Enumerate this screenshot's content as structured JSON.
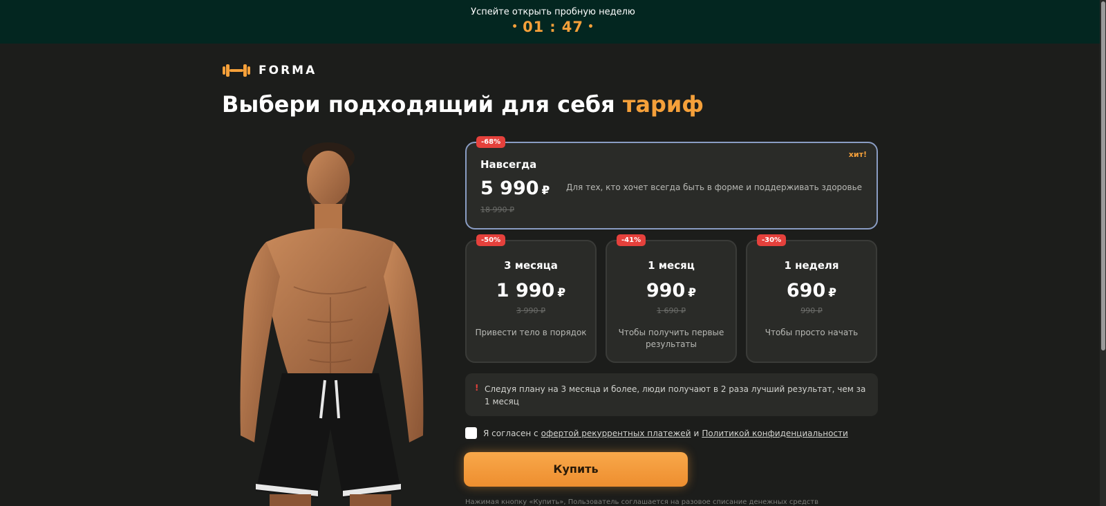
{
  "banner": {
    "text": "Успейте открыть пробную неделю",
    "timer_minutes": "01",
    "timer_seconds": "47",
    "dot": "•",
    "colon": ":"
  },
  "logo": {
    "text": "FORMA"
  },
  "heading": {
    "main": "Выбери подходящий для себя ",
    "accent": "тариф"
  },
  "plans": {
    "forever": {
      "badge": "-68%",
      "hit": "хит!",
      "title": "Навсегда",
      "price": "5 990",
      "currency": "₽",
      "old_price": "18 990 ₽",
      "description": "Для тех, кто хочет всегда быть в форме и поддерживать здоровье"
    },
    "items": [
      {
        "badge": "-50%",
        "title": "3 месяца",
        "price": "1 990",
        "currency": "₽",
        "old_price": "3 990 ₽",
        "description": "Привести тело в порядок"
      },
      {
        "badge": "-41%",
        "title": "1 месяц",
        "price": "990",
        "currency": "₽",
        "old_price": "1 690 ₽",
        "description": "Чтобы получить первые результаты"
      },
      {
        "badge": "-30%",
        "title": "1 неделя",
        "price": "690",
        "currency": "₽",
        "old_price": "990 ₽",
        "description": "Чтобы просто начать"
      }
    ]
  },
  "info": {
    "mark": "!",
    "text": "Следуя плану на 3 месяца и более, люди получают в 2 раза лучший результат, чем за 1 месяц"
  },
  "agreement": {
    "prefix": "Я согласен с",
    "offer_link": "офертой рекуррентных платежей",
    "and": "и",
    "policy_link": "Политикой конфиденциальности"
  },
  "buy_button": "Купить",
  "footnote": "Нажимая кнопку «Купить», Пользователь соглашается на разовое списание денежных средств",
  "colors": {
    "accent": "#f5a03a",
    "banner_bg": "#032620",
    "badge": "#e5413c",
    "page_bg": "#1c1d1b"
  }
}
